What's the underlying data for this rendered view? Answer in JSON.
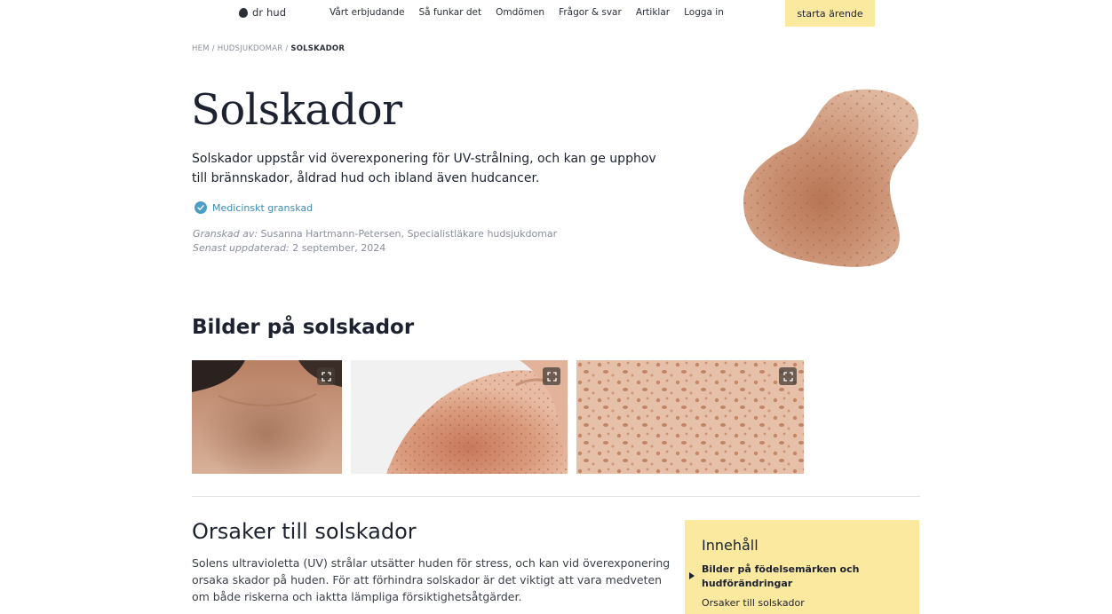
{
  "header": {
    "logo_text": "dr hud",
    "nav": [
      "Vårt erbjudande",
      "Så funkar det",
      "Omdömen",
      "Frågor & svar",
      "Artiklar",
      "Logga in"
    ],
    "cta_label": "starta ärende"
  },
  "breadcrumb": {
    "items": [
      "HEM",
      "HUDSJUKDOMAR",
      "SOLSKADOR"
    ],
    "separator": "/"
  },
  "hero": {
    "title": "Solskador",
    "lead": "Solskador uppstår vid överexponering för UV-strålning, och kan ge upphov till brännskador, åldrad hud och ibland även hudcancer.",
    "reviewed_badge": "Medicinskt granskad",
    "reviewed_by_label": "Granskad av:",
    "reviewed_by_value": "Susanna Hartmann-Petersen, Specialistläkare hudsjukdomar",
    "updated_label": "Senast uppdaterad:",
    "updated_value": "2 september, 2024"
  },
  "gallery": {
    "title": "Bilder på solskador",
    "images": [
      {
        "icon": "expand-icon"
      },
      {
        "icon": "expand-icon"
      },
      {
        "icon": "expand-icon"
      }
    ]
  },
  "causes": {
    "title": "Orsaker till solskador",
    "text": "Solens ultravioletta (UV) strålar utsätter huden för stress, och kan vid överexponering orsaka skador på huden. För att förhindra solskador är det viktigt att vara medveten om både riskerna och iaktta lämpliga försiktighetsåtgärder."
  },
  "toc": {
    "title": "Innehåll",
    "active_item": "Bilder på födelsemärken och hudförändringar",
    "items": [
      "Orsaker till solskador"
    ]
  },
  "colors": {
    "accent_yellow": "#fbe9a0",
    "review_blue": "#3b8bb0",
    "text_dark": "#1c2230"
  }
}
